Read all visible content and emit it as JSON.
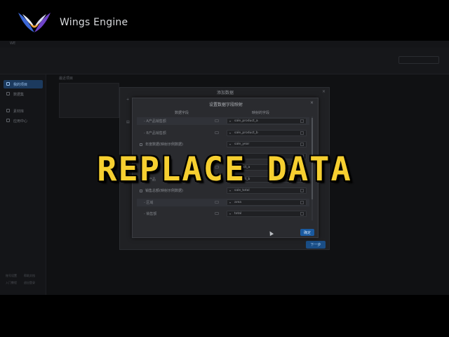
{
  "window": {
    "title": "WE"
  },
  "brand": {
    "name": "Wings Engine"
  },
  "topbar": {
    "search_text": ""
  },
  "sidebar": {
    "items": [
      {
        "label": "我的项目",
        "active": true
      },
      {
        "label": "数据集",
        "active": false
      },
      {
        "label": "素材库",
        "active": false
      },
      {
        "label": "应用中心",
        "active": false
      }
    ],
    "footer": [
      "账号设置",
      "帮助文档",
      "入门教程",
      "退出登录"
    ]
  },
  "workspace": {
    "label": "最近项目"
  },
  "outer_dialog": {
    "title": "添加数据",
    "close_glyph": "×",
    "next_label": "下一步"
  },
  "inner_dialog": {
    "title": "设置数据字段映射",
    "close_glyph": "×",
    "col_source": "数据字段",
    "col_target": "映射的字段",
    "confirm_label": "确定",
    "rows": [
      {
        "label": "A产品销售额",
        "group": false,
        "selected": true,
        "field": "sale_product_a"
      },
      {
        "label": "B产品销售额",
        "group": false,
        "selected": false,
        "field": "sale_product_b"
      },
      {
        "label": "年度数据(映射示例数据)",
        "group": true,
        "selected": false,
        "field": "sale_year"
      },
      {
        "label": "",
        "group": false,
        "selected": false,
        "field": ""
      },
      {
        "label": "A产品",
        "group": false,
        "selected": false,
        "field": "product_a"
      },
      {
        "label": "B产品",
        "group": false,
        "selected": false,
        "field": "product_b"
      },
      {
        "label": "销售总额(映射示例数据)",
        "group": true,
        "selected": false,
        "field": "sale_total"
      },
      {
        "label": "区域",
        "group": false,
        "selected": true,
        "field": "area"
      },
      {
        "label": "销售额",
        "group": false,
        "selected": false,
        "field": "total"
      }
    ]
  },
  "overlay": {
    "caption": "REPLACE DATA"
  },
  "colors": {
    "accent": "#1a5aa0",
    "caption": "#f6cf30",
    "active_nav": "#1c3a5e"
  }
}
